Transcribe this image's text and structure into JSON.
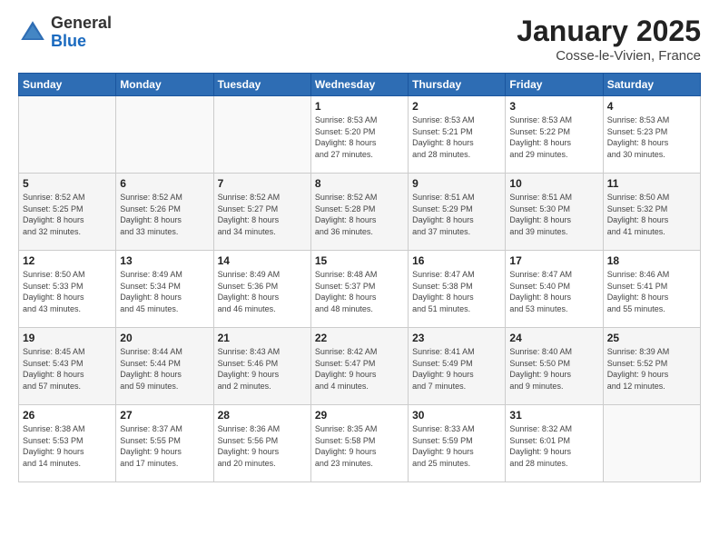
{
  "header": {
    "logo_general": "General",
    "logo_blue": "Blue",
    "title": "January 2025",
    "location": "Cosse-le-Vivien, France"
  },
  "weekdays": [
    "Sunday",
    "Monday",
    "Tuesday",
    "Wednesday",
    "Thursday",
    "Friday",
    "Saturday"
  ],
  "weeks": [
    [
      {
        "day": "",
        "info": ""
      },
      {
        "day": "",
        "info": ""
      },
      {
        "day": "",
        "info": ""
      },
      {
        "day": "1",
        "info": "Sunrise: 8:53 AM\nSunset: 5:20 PM\nDaylight: 8 hours\nand 27 minutes."
      },
      {
        "day": "2",
        "info": "Sunrise: 8:53 AM\nSunset: 5:21 PM\nDaylight: 8 hours\nand 28 minutes."
      },
      {
        "day": "3",
        "info": "Sunrise: 8:53 AM\nSunset: 5:22 PM\nDaylight: 8 hours\nand 29 minutes."
      },
      {
        "day": "4",
        "info": "Sunrise: 8:53 AM\nSunset: 5:23 PM\nDaylight: 8 hours\nand 30 minutes."
      }
    ],
    [
      {
        "day": "5",
        "info": "Sunrise: 8:52 AM\nSunset: 5:25 PM\nDaylight: 8 hours\nand 32 minutes."
      },
      {
        "day": "6",
        "info": "Sunrise: 8:52 AM\nSunset: 5:26 PM\nDaylight: 8 hours\nand 33 minutes."
      },
      {
        "day": "7",
        "info": "Sunrise: 8:52 AM\nSunset: 5:27 PM\nDaylight: 8 hours\nand 34 minutes."
      },
      {
        "day": "8",
        "info": "Sunrise: 8:52 AM\nSunset: 5:28 PM\nDaylight: 8 hours\nand 36 minutes."
      },
      {
        "day": "9",
        "info": "Sunrise: 8:51 AM\nSunset: 5:29 PM\nDaylight: 8 hours\nand 37 minutes."
      },
      {
        "day": "10",
        "info": "Sunrise: 8:51 AM\nSunset: 5:30 PM\nDaylight: 8 hours\nand 39 minutes."
      },
      {
        "day": "11",
        "info": "Sunrise: 8:50 AM\nSunset: 5:32 PM\nDaylight: 8 hours\nand 41 minutes."
      }
    ],
    [
      {
        "day": "12",
        "info": "Sunrise: 8:50 AM\nSunset: 5:33 PM\nDaylight: 8 hours\nand 43 minutes."
      },
      {
        "day": "13",
        "info": "Sunrise: 8:49 AM\nSunset: 5:34 PM\nDaylight: 8 hours\nand 45 minutes."
      },
      {
        "day": "14",
        "info": "Sunrise: 8:49 AM\nSunset: 5:36 PM\nDaylight: 8 hours\nand 46 minutes."
      },
      {
        "day": "15",
        "info": "Sunrise: 8:48 AM\nSunset: 5:37 PM\nDaylight: 8 hours\nand 48 minutes."
      },
      {
        "day": "16",
        "info": "Sunrise: 8:47 AM\nSunset: 5:38 PM\nDaylight: 8 hours\nand 51 minutes."
      },
      {
        "day": "17",
        "info": "Sunrise: 8:47 AM\nSunset: 5:40 PM\nDaylight: 8 hours\nand 53 minutes."
      },
      {
        "day": "18",
        "info": "Sunrise: 8:46 AM\nSunset: 5:41 PM\nDaylight: 8 hours\nand 55 minutes."
      }
    ],
    [
      {
        "day": "19",
        "info": "Sunrise: 8:45 AM\nSunset: 5:43 PM\nDaylight: 8 hours\nand 57 minutes."
      },
      {
        "day": "20",
        "info": "Sunrise: 8:44 AM\nSunset: 5:44 PM\nDaylight: 8 hours\nand 59 minutes."
      },
      {
        "day": "21",
        "info": "Sunrise: 8:43 AM\nSunset: 5:46 PM\nDaylight: 9 hours\nand 2 minutes."
      },
      {
        "day": "22",
        "info": "Sunrise: 8:42 AM\nSunset: 5:47 PM\nDaylight: 9 hours\nand 4 minutes."
      },
      {
        "day": "23",
        "info": "Sunrise: 8:41 AM\nSunset: 5:49 PM\nDaylight: 9 hours\nand 7 minutes."
      },
      {
        "day": "24",
        "info": "Sunrise: 8:40 AM\nSunset: 5:50 PM\nDaylight: 9 hours\nand 9 minutes."
      },
      {
        "day": "25",
        "info": "Sunrise: 8:39 AM\nSunset: 5:52 PM\nDaylight: 9 hours\nand 12 minutes."
      }
    ],
    [
      {
        "day": "26",
        "info": "Sunrise: 8:38 AM\nSunset: 5:53 PM\nDaylight: 9 hours\nand 14 minutes."
      },
      {
        "day": "27",
        "info": "Sunrise: 8:37 AM\nSunset: 5:55 PM\nDaylight: 9 hours\nand 17 minutes."
      },
      {
        "day": "28",
        "info": "Sunrise: 8:36 AM\nSunset: 5:56 PM\nDaylight: 9 hours\nand 20 minutes."
      },
      {
        "day": "29",
        "info": "Sunrise: 8:35 AM\nSunset: 5:58 PM\nDaylight: 9 hours\nand 23 minutes."
      },
      {
        "day": "30",
        "info": "Sunrise: 8:33 AM\nSunset: 5:59 PM\nDaylight: 9 hours\nand 25 minutes."
      },
      {
        "day": "31",
        "info": "Sunrise: 8:32 AM\nSunset: 6:01 PM\nDaylight: 9 hours\nand 28 minutes."
      },
      {
        "day": "",
        "info": ""
      }
    ]
  ]
}
